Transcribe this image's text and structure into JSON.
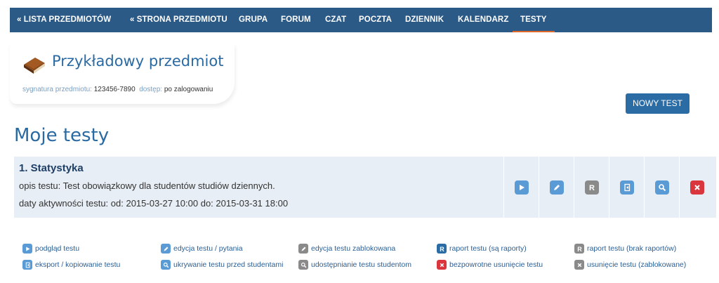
{
  "nav": {
    "items": [
      {
        "label": "« LISTA PRZEDMIOTÓW",
        "active": false
      },
      {
        "label": "« STRONA PRZEDMIOTU",
        "active": false
      },
      {
        "label": "GRUPA",
        "active": false
      },
      {
        "label": "FORUM",
        "active": false
      },
      {
        "label": "CZAT",
        "active": false
      },
      {
        "label": "POCZTA",
        "active": false
      },
      {
        "label": "DZIENNIK",
        "active": false
      },
      {
        "label": "KALENDARZ",
        "active": false
      },
      {
        "label": "TESTY",
        "active": true
      }
    ]
  },
  "subject": {
    "title": "Przykładowy przedmiot",
    "signature_label": "sygnatura przedmiotu:",
    "signature_value": "123456-7890",
    "access_label": "dostęp:",
    "access_value": "po zalogowaniu",
    "icon": "book-icon"
  },
  "new_test_button": "NOWY TEST",
  "page_title": "Moje testy",
  "test": {
    "name": "1. Statystyka",
    "description": "opis testu: Test obowiązkowy dla studentów studiów dziennych.",
    "dates": "daty aktywności testu: od: 2015-03-27 10:00 do: 2015-03-31 18:00",
    "actions": [
      {
        "name": "preview",
        "icon": "play-icon",
        "color": "#5b9bd5"
      },
      {
        "name": "edit",
        "icon": "pencil-icon",
        "color": "#5b9bd5"
      },
      {
        "name": "report",
        "icon": "report-r-icon",
        "color": "#8a8a8a"
      },
      {
        "name": "export",
        "icon": "export-icon",
        "color": "#5b9bd5"
      },
      {
        "name": "hide",
        "icon": "magnifier-icon",
        "color": "#5b9bd5"
      },
      {
        "name": "delete",
        "icon": "delete-x-icon",
        "color": "#d9363e"
      }
    ]
  },
  "legend": [
    {
      "label": "podgląd testu",
      "icon": "play-icon",
      "color": "#5b9bd5"
    },
    {
      "label": "edycja testu / pytania",
      "icon": "pencil-icon",
      "color": "#5b9bd5"
    },
    {
      "label": "edycja testu zablokowana",
      "icon": "pencil-icon",
      "color": "#8a8a8a"
    },
    {
      "label": "raport testu (są raporty)",
      "icon": "report-r-icon",
      "color": "#2b6ca5"
    },
    {
      "label": "raport testu (brak raportów)",
      "icon": "report-r-icon",
      "color": "#8a8a8a"
    },
    {
      "label": "eksport / kopiowanie testu",
      "icon": "export-icon",
      "color": "#5b9bd5"
    },
    {
      "label": "ukrywanie testu przed studentami",
      "icon": "magnifier-icon",
      "color": "#5b9bd5"
    },
    {
      "label": "udostępnianie testu studentom",
      "icon": "magnifier-icon",
      "color": "#8a8a8a"
    },
    {
      "label": "bezpowrotne usunięcie testu",
      "icon": "delete-x-icon",
      "color": "#d9363e"
    },
    {
      "label": "usunięcie testu (zablokowane)",
      "icon": "delete-x-icon",
      "color": "#8a8a8a"
    }
  ]
}
